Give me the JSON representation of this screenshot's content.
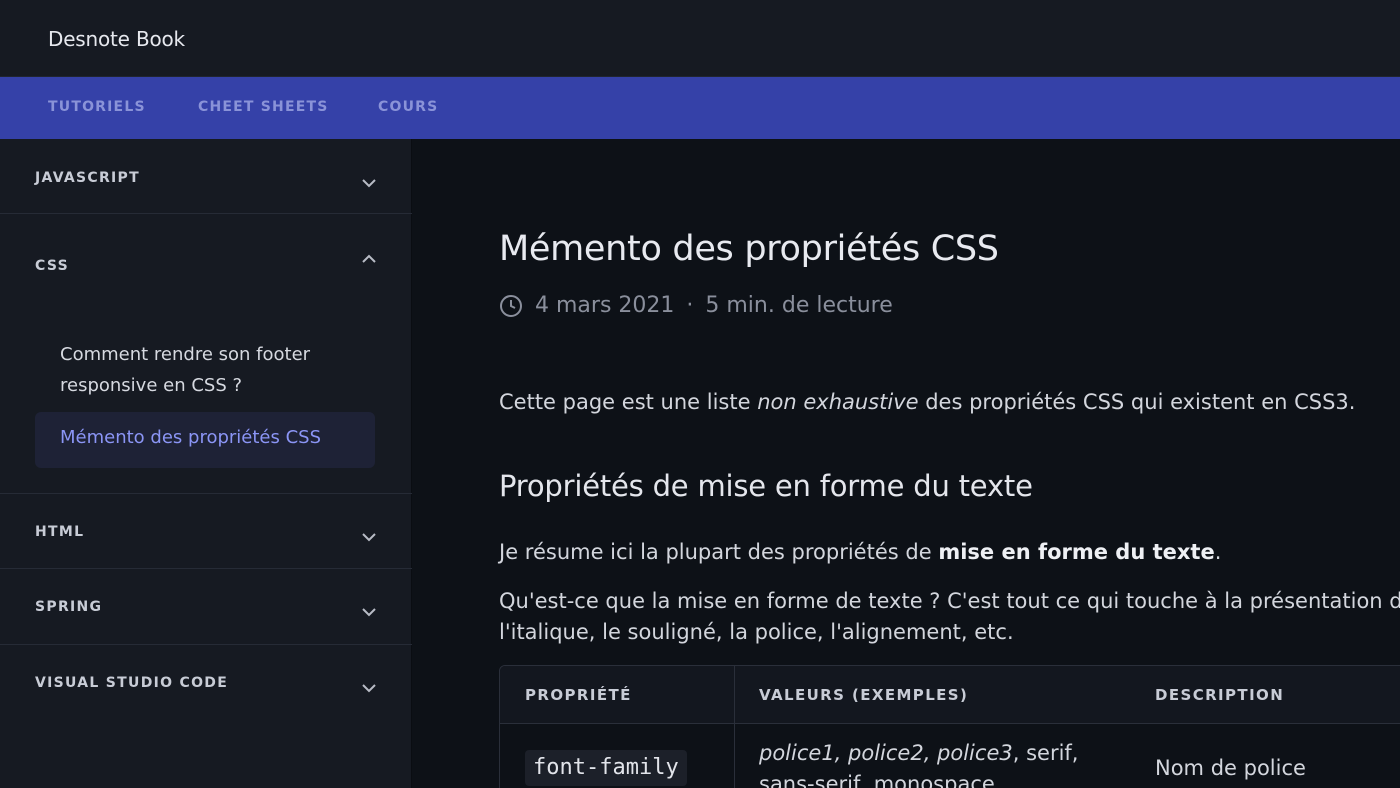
{
  "header": {
    "brand": "Desnote Book"
  },
  "nav": {
    "items": [
      "TUTORIELS",
      "CHEET SHEETS",
      "COURS"
    ]
  },
  "sidebar": {
    "sections": [
      {
        "title": "JAVASCRIPT",
        "expanded": false
      },
      {
        "title": "CSS",
        "expanded": true
      },
      {
        "title": "HTML",
        "expanded": false
      },
      {
        "title": "SPRING",
        "expanded": false
      },
      {
        "title": "VISUAL STUDIO CODE",
        "expanded": false
      }
    ],
    "css_items": [
      "Comment rendre son footer responsive en CSS ?",
      "Mémento des propriétés CSS"
    ],
    "active_item": "Mémento des propriétés CSS"
  },
  "article": {
    "title": "Mémento des propriétés CSS",
    "date": "4 mars 2021",
    "separator": "·",
    "reading_time": "5 min. de lecture",
    "intro_before": "Cette page est une liste ",
    "intro_em": "non exhaustive",
    "intro_after": " des propriétés CSS qui existent en CSS3.",
    "section_title": "Propriétés de mise en forme du texte",
    "p2_before": "Je résume ici la plupart des propriétés de ",
    "p2_strong": "mise en forme du texte",
    "p2_after": ".",
    "p3_line1": "Qu'est-ce que la mise en forme de texte ? C'est tout ce qui touche à la présentation d",
    "p3_line2": "l'italique, le souligné, la police, l'alignement, etc.",
    "table": {
      "headers": [
        "PROPRIÉTÉ",
        "VALEURS (EXEMPLES)",
        "DESCRIPTION"
      ],
      "rows": [
        {
          "property": "font-family",
          "values_em": "police1, police2, police3",
          "values_rest": ", serif,",
          "values_line2": "sans-serif, monospace",
          "description": "Nom de police"
        }
      ]
    }
  },
  "colors": {
    "nav_bar": "#3541a8",
    "nav_text": "#8a93d8",
    "active_text": "#8b95f5",
    "background": "#0d1117",
    "sidebar": "#161a22"
  }
}
